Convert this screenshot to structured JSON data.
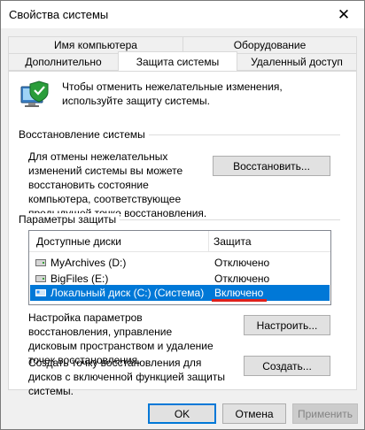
{
  "window": {
    "title": "Свойства системы"
  },
  "tabs": {
    "row1": [
      "Имя компьютера",
      "Оборудование"
    ],
    "row2": [
      "Дополнительно",
      "Защита системы",
      "Удаленный доступ"
    ]
  },
  "intro": "Чтобы отменить нежелательные изменения, используйте защиту системы.",
  "restore": {
    "group_title": "Восстановление системы",
    "description": "Для отмены нежелательных изменений системы вы можете восстановить состояние компьютера, соответствующее предыдущей точке восстановления.",
    "button": "Восстановить..."
  },
  "protection": {
    "group_title": "Параметры защиты",
    "columns": [
      "Доступные диски",
      "Защита"
    ],
    "drives": [
      {
        "name": "MyArchives (D:)",
        "status": "Отключено",
        "icon": "drive-icon"
      },
      {
        "name": "BigFiles (E:)",
        "status": "Отключено",
        "icon": "drive-icon"
      },
      {
        "name": "Локальный диск (C:) (Система)",
        "status": "Включено",
        "icon": "system-drive-icon"
      }
    ],
    "configure_text": "Настройка параметров восстановления, управление дисковым пространством и удаление точек восстановления.",
    "configure_button": "Настроить...",
    "create_text": "Создать точку восстановления для дисков с включенной функцией защиты системы.",
    "create_button": "Создать..."
  },
  "footer": {
    "ok": "OK",
    "cancel": "Отмена",
    "apply": "Применить"
  },
  "colors": {
    "selection": "#0078d7",
    "highlight_underline": "#e0201b"
  }
}
